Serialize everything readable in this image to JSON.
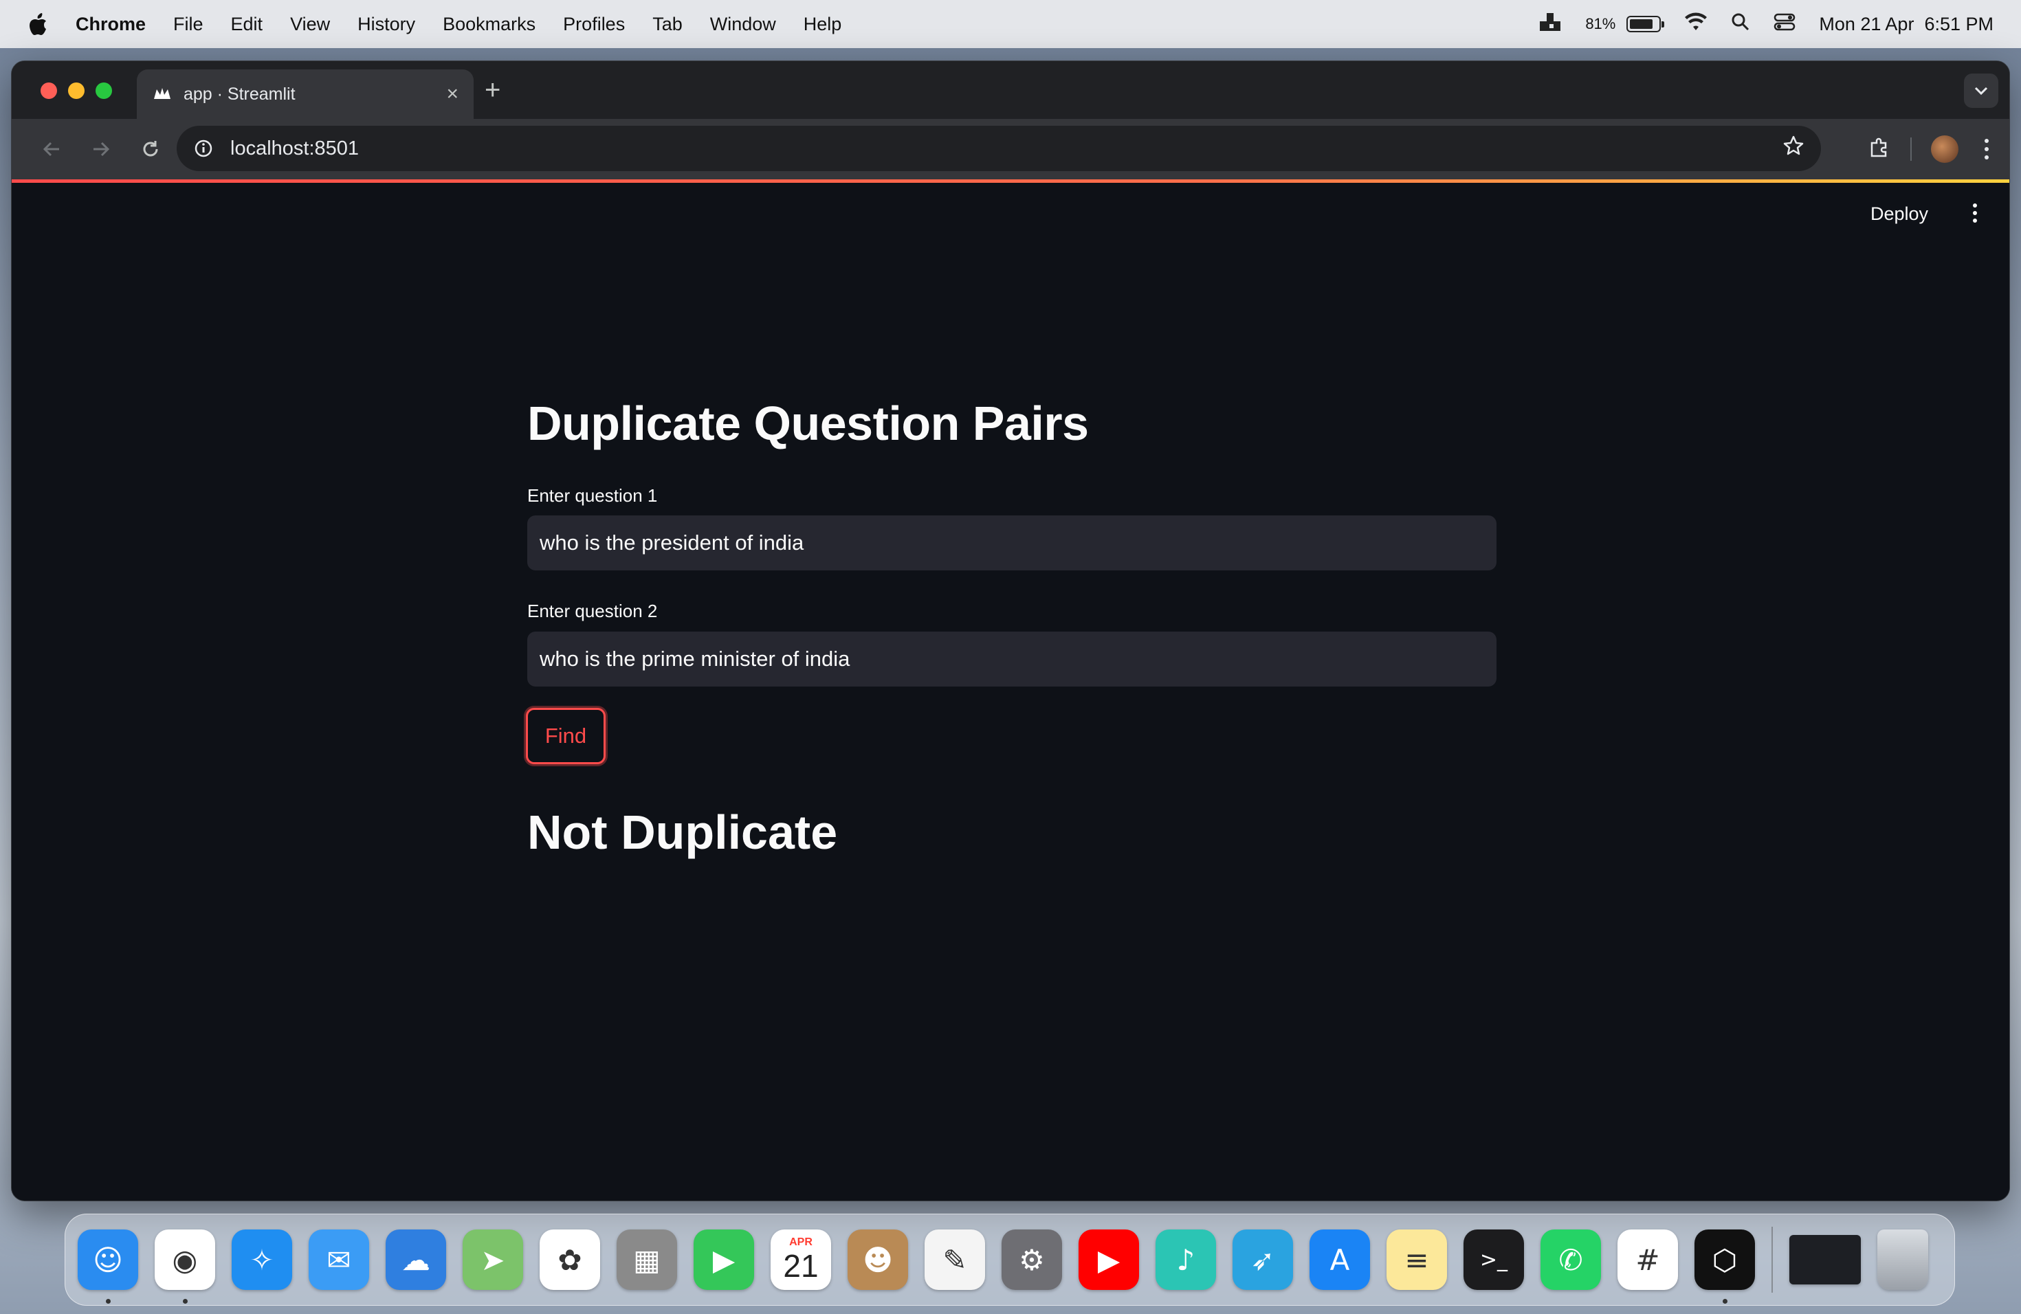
{
  "menubar": {
    "app_name": "Chrome",
    "items": [
      "File",
      "Edit",
      "View",
      "History",
      "Bookmarks",
      "Profiles",
      "Tab",
      "Window",
      "Help"
    ],
    "battery": "81%",
    "battery_level": 0.81,
    "datetime": "Mon 21 Apr  6:51 PM"
  },
  "browser": {
    "tab_title": "app · Streamlit",
    "new_tab_label": "+",
    "tab_close": "×",
    "url": "localhost:8501"
  },
  "app": {
    "deploy_label": "Deploy",
    "title": "Duplicate Question Pairs",
    "q1_label": "Enter question 1",
    "q1_value": "who is the president of india",
    "q2_label": "Enter question 2",
    "q2_value": "who is the prime minister of india",
    "button_label": "Find",
    "result": "Not Duplicate",
    "accent_color": "#ff4b4b",
    "background_color": "#0e1117"
  },
  "dock": {
    "apps": [
      {
        "name": "finder-icon",
        "color": "#2a8cf0",
        "glyph": "☺"
      },
      {
        "name": "chrome-icon",
        "color": "#ffffff",
        "glyph": "◉"
      },
      {
        "name": "safari-icon",
        "color": "#1f8ef1",
        "glyph": "✧"
      },
      {
        "name": "mail-icon",
        "color": "#3b9cf5",
        "glyph": "✉"
      },
      {
        "name": "weather-icon",
        "color": "#2f7fe0",
        "glyph": "☁"
      },
      {
        "name": "maps-icon",
        "color": "#7cc36a",
        "glyph": "➤"
      },
      {
        "name": "photos-icon",
        "color": "#ffffff",
        "glyph": "✿"
      },
      {
        "name": "calculator-icon",
        "color": "#8a8a8a",
        "glyph": "▦"
      },
      {
        "name": "facetime-icon",
        "color": "#34c759",
        "glyph": "▶"
      },
      {
        "name": "calendar-icon",
        "color": "#ffffff",
        "glyph": "21",
        "month": "APR"
      },
      {
        "name": "contacts-icon",
        "color": "#b98a55",
        "glyph": "☻"
      },
      {
        "name": "textedit-icon",
        "color": "#f4f4f4",
        "glyph": "✎"
      },
      {
        "name": "system-settings-icon",
        "color": "#6e6e73",
        "glyph": "⚙"
      },
      {
        "name": "youtube-icon",
        "color": "#ff0000",
        "glyph": "▶"
      },
      {
        "name": "jiosaavn-icon",
        "color": "#2bc5b4",
        "glyph": "♪"
      },
      {
        "name": "telegram-icon",
        "color": "#2aa3e0",
        "glyph": "➶"
      },
      {
        "name": "app-store-icon",
        "color": "#1a84f5",
        "glyph": "A"
      },
      {
        "name": "notes-icon",
        "color": "#fce89a",
        "glyph": "≡"
      },
      {
        "name": "terminal-icon",
        "color": "#1c1c1e",
        "glyph": ">_"
      },
      {
        "name": "whatsapp-icon",
        "color": "#25d366",
        "glyph": "✆"
      },
      {
        "name": "slack-icon",
        "color": "#ffffff",
        "glyph": "#"
      },
      {
        "name": "cursor-icon",
        "color": "#111111",
        "glyph": "⬡"
      }
    ]
  }
}
